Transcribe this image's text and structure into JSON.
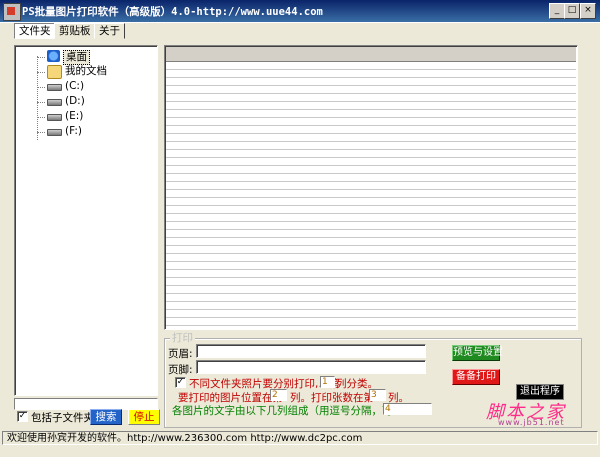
{
  "window": {
    "title": "PS批量图片打印软件（高级版）4.0-http://www.uue44.com",
    "buttons": {
      "minimize": "_",
      "maximize": "□",
      "close": "×"
    }
  },
  "tabs": [
    {
      "label": "文件夹",
      "active": true
    },
    {
      "label": "剪贴板",
      "active": false
    },
    {
      "label": "关于",
      "active": false
    }
  ],
  "tree": {
    "items": [
      {
        "label": "桌面",
        "icon": "desktop-icon",
        "selected": true
      },
      {
        "label": "我的文档",
        "icon": "documents-icon",
        "selected": false
      },
      {
        "label": "(C:)",
        "icon": "drive-icon",
        "selected": false
      },
      {
        "label": "(D:)",
        "icon": "drive-icon",
        "selected": false
      },
      {
        "label": "(E:)",
        "icon": "drive-icon",
        "selected": false
      },
      {
        "label": "(F:)",
        "icon": "drive-icon",
        "selected": false
      }
    ]
  },
  "left_controls": {
    "include_subfolders_label": "包括子文件夹",
    "include_subfolders_checked": true,
    "search_label": "搜索",
    "stop_label": "停止"
  },
  "print": {
    "group_label": "打印",
    "header_label": "页眉:",
    "header_value": "",
    "footer_label": "页脚:",
    "footer_value": "",
    "separate_folders_label": "不同文件夹照片要分别打印,以第",
    "separate_folders_checked": true,
    "separate_col_value": "1",
    "separate_suffix": "列分类。",
    "pos_label": "要打印的图片位置在第",
    "pos_value": "2",
    "pos_mid": "列。打印张数在第",
    "count_value": "3",
    "count_suffix": "列。",
    "text_cols_label": "各图片的文字由以下几列组成（用逗号分隔，可空）:",
    "text_cols_value": "4",
    "preview_button": "预览与设置",
    "backup_button": "备备打印",
    "exit_button": "退出程序"
  },
  "watermark": {
    "text": "脚本之家",
    "url": "www.jb51.net"
  },
  "statusbar": {
    "text": "欢迎使用孙宾开发的软件。http://www.236300.com http://www.dc2pc.com"
  },
  "colors": {
    "titlebar": "#0a246a",
    "search_btn": "#2463c7",
    "stop_btn": "#ffff00",
    "preview_btn": "#1f8a1f",
    "backup_btn": "#e01818",
    "exit_btn": "#000000"
  }
}
